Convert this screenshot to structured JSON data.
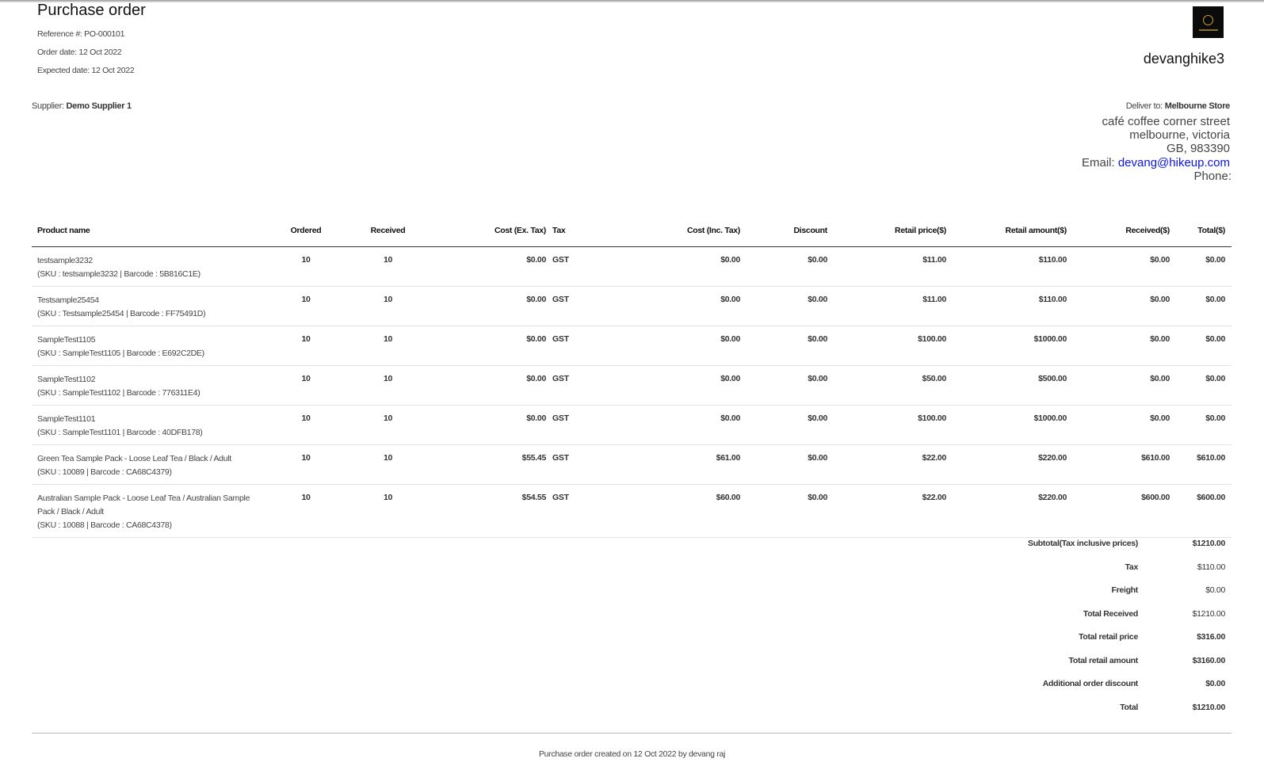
{
  "document": {
    "title": "Purchase order",
    "reference": "Reference #: PO-000101",
    "order_date": "Order date: 12 Oct 2022",
    "expected_date": "Expected date: 12 Oct 2022",
    "store_name": "devanghike3",
    "supplier_label": "Supplier:",
    "supplier_name": "Demo Supplier 1",
    "deliver_label": "Deliver to:",
    "deliver_store": "Melbourne Store",
    "address_line1": "café coffee corner street",
    "address_line2": "melbourne, victoria",
    "address_line3": "GB, 983390",
    "email_label": "Email:",
    "email": "devang@hikeup.com",
    "phone_label": "Phone:",
    "footer": "Purchase order created on 12 Oct 2022 by devang raj"
  },
  "table": {
    "headers": [
      "Product name",
      "Ordered",
      "Received",
      "Cost (Ex. Tax)",
      "Tax",
      "Cost (Inc. Tax)",
      "Discount",
      "Retail price($)",
      "Retail amount($)",
      "Received($)",
      "Total($)"
    ],
    "rows": [
      {
        "name": "testsample3232",
        "sku": "(SKU : testsample3232 | Barcode : 5B816C1E)",
        "ordered": "10",
        "received": "10",
        "cost_ex": "$0.00",
        "tax": "GST",
        "cost_inc": "$0.00",
        "discount": "$0.00",
        "retail_price": "$11.00",
        "retail_amount": "$110.00",
        "received_amt": "$0.00",
        "total": "$0.00"
      },
      {
        "name": "Testsample25454",
        "sku": "(SKU : Testsample25454 | Barcode : FF75491D)",
        "ordered": "10",
        "received": "10",
        "cost_ex": "$0.00",
        "tax": "GST",
        "cost_inc": "$0.00",
        "discount": "$0.00",
        "retail_price": "$11.00",
        "retail_amount": "$110.00",
        "received_amt": "$0.00",
        "total": "$0.00"
      },
      {
        "name": "SampleTest1105",
        "sku": "(SKU : SampleTest1105 | Barcode : E692C2DE)",
        "ordered": "10",
        "received": "10",
        "cost_ex": "$0.00",
        "tax": "GST",
        "cost_inc": "$0.00",
        "discount": "$0.00",
        "retail_price": "$100.00",
        "retail_amount": "$1000.00",
        "received_amt": "$0.00",
        "total": "$0.00"
      },
      {
        "name": "SampleTest1102",
        "sku": "(SKU : SampleTest1102 | Barcode : 776311E4)",
        "ordered": "10",
        "received": "10",
        "cost_ex": "$0.00",
        "tax": "GST",
        "cost_inc": "$0.00",
        "discount": "$0.00",
        "retail_price": "$50.00",
        "retail_amount": "$500.00",
        "received_amt": "$0.00",
        "total": "$0.00"
      },
      {
        "name": "SampleTest1101",
        "sku": "(SKU : SampleTest1101 | Barcode : 40DFB178)",
        "ordered": "10",
        "received": "10",
        "cost_ex": "$0.00",
        "tax": "GST",
        "cost_inc": "$0.00",
        "discount": "$0.00",
        "retail_price": "$100.00",
        "retail_amount": "$1000.00",
        "received_amt": "$0.00",
        "total": "$0.00"
      },
      {
        "name": "Green Tea Sample Pack - Loose Leaf Tea / Black / Adult",
        "sku": "(SKU : 10089 | Barcode : CA68C4379)",
        "ordered": "10",
        "received": "10",
        "cost_ex": "$55.45",
        "tax": "GST",
        "cost_inc": "$61.00",
        "discount": "$0.00",
        "retail_price": "$22.00",
        "retail_amount": "$220.00",
        "received_amt": "$610.00",
        "total": "$610.00"
      },
      {
        "name": "Australian Sample Pack - Loose Leaf Tea / Australian Sample Pack / Black / Adult",
        "sku": "(SKU : 10088 | Barcode : CA68C4378)",
        "ordered": "10",
        "received": "10",
        "cost_ex": "$54.55",
        "tax": "GST",
        "cost_inc": "$60.00",
        "discount": "$0.00",
        "retail_price": "$22.00",
        "retail_amount": "$220.00",
        "received_amt": "$600.00",
        "total": "$600.00"
      }
    ]
  },
  "totals": [
    {
      "label": "Subtotal(Tax inclusive prices)",
      "value": "$1210.00",
      "bold": true
    },
    {
      "label": "Tax",
      "value": "$110.00",
      "bold": false
    },
    {
      "label": "Freight",
      "value": "$0.00",
      "bold": false
    },
    {
      "label": "Total Received",
      "value": "$1210.00",
      "bold": false
    },
    {
      "label": "Total retail price",
      "value": "$316.00",
      "bold": true
    },
    {
      "label": "Total retail amount",
      "value": "$3160.00",
      "bold": true
    },
    {
      "label": "Additional order discount",
      "value": "$0.00",
      "bold": true
    },
    {
      "label": "Total",
      "value": "$1210.00",
      "bold": true
    }
  ]
}
